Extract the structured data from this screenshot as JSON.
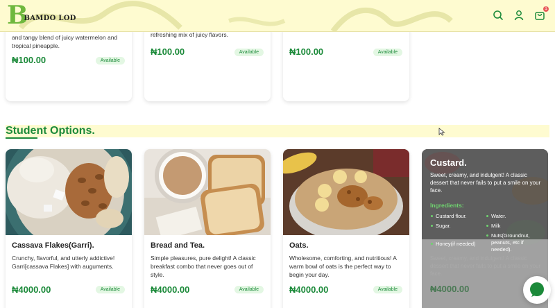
{
  "brand": {
    "letter": "B",
    "name": "BAMDO LOD"
  },
  "header": {
    "cart_count": "1",
    "icons": [
      "search-icon",
      "user-icon",
      "cart-icon"
    ]
  },
  "top_cards": [
    {
      "desc": "and tangy blend of juicy watermelon and tropical pineapple.",
      "price": "₦100.00",
      "badge": "Available"
    },
    {
      "desc": "refreshing mix of juicy flavors.",
      "price": "₦100.00",
      "badge": "Available"
    },
    {
      "desc": "",
      "price": "₦100.00",
      "badge": "Available"
    }
  ],
  "section": {
    "title": "Student Options."
  },
  "products": [
    {
      "name": "Cassava Flakes(Garri).",
      "desc": "Crunchy, flavorful, and utterly addictive! Garri[cassava Flakes] with auguments.",
      "price": "₦4000.00",
      "badge": "Available"
    },
    {
      "name": "Bread and Tea.",
      "desc": "Simple pleasures, pure delight! A classic breakfast combo that never goes out of style.",
      "price": "₦4000.00",
      "badge": "Available"
    },
    {
      "name": "Oats.",
      "desc": "Wholesome, comforting, and nutritious! A warm bowl of oats is the perfect way to begin your day.",
      "price": "₦4000.00",
      "badge": "Available"
    }
  ],
  "overlay_card": {
    "title": "Custard.",
    "desc": "Sweet, creamy, and indulgent! A classic dessert that never fails to put a smile on your face.",
    "ingredients_label": "Ingredients:",
    "ingredients": [
      "Custard flour.",
      "Water.",
      "Sugar.",
      "Milk",
      "Honey(if needed)",
      "Nuts(Groundnut, peanuts, etc if needed)."
    ],
    "ghost_desc": "Sweet, creamy, and indulgent! A classic dessert that never fails to put a smile on your face.",
    "ghost_price": "₦4000.00"
  },
  "colors": {
    "accent": "#1c8a3a",
    "header_bg": "#fefbd0",
    "logo_green": "#6fb83e"
  }
}
